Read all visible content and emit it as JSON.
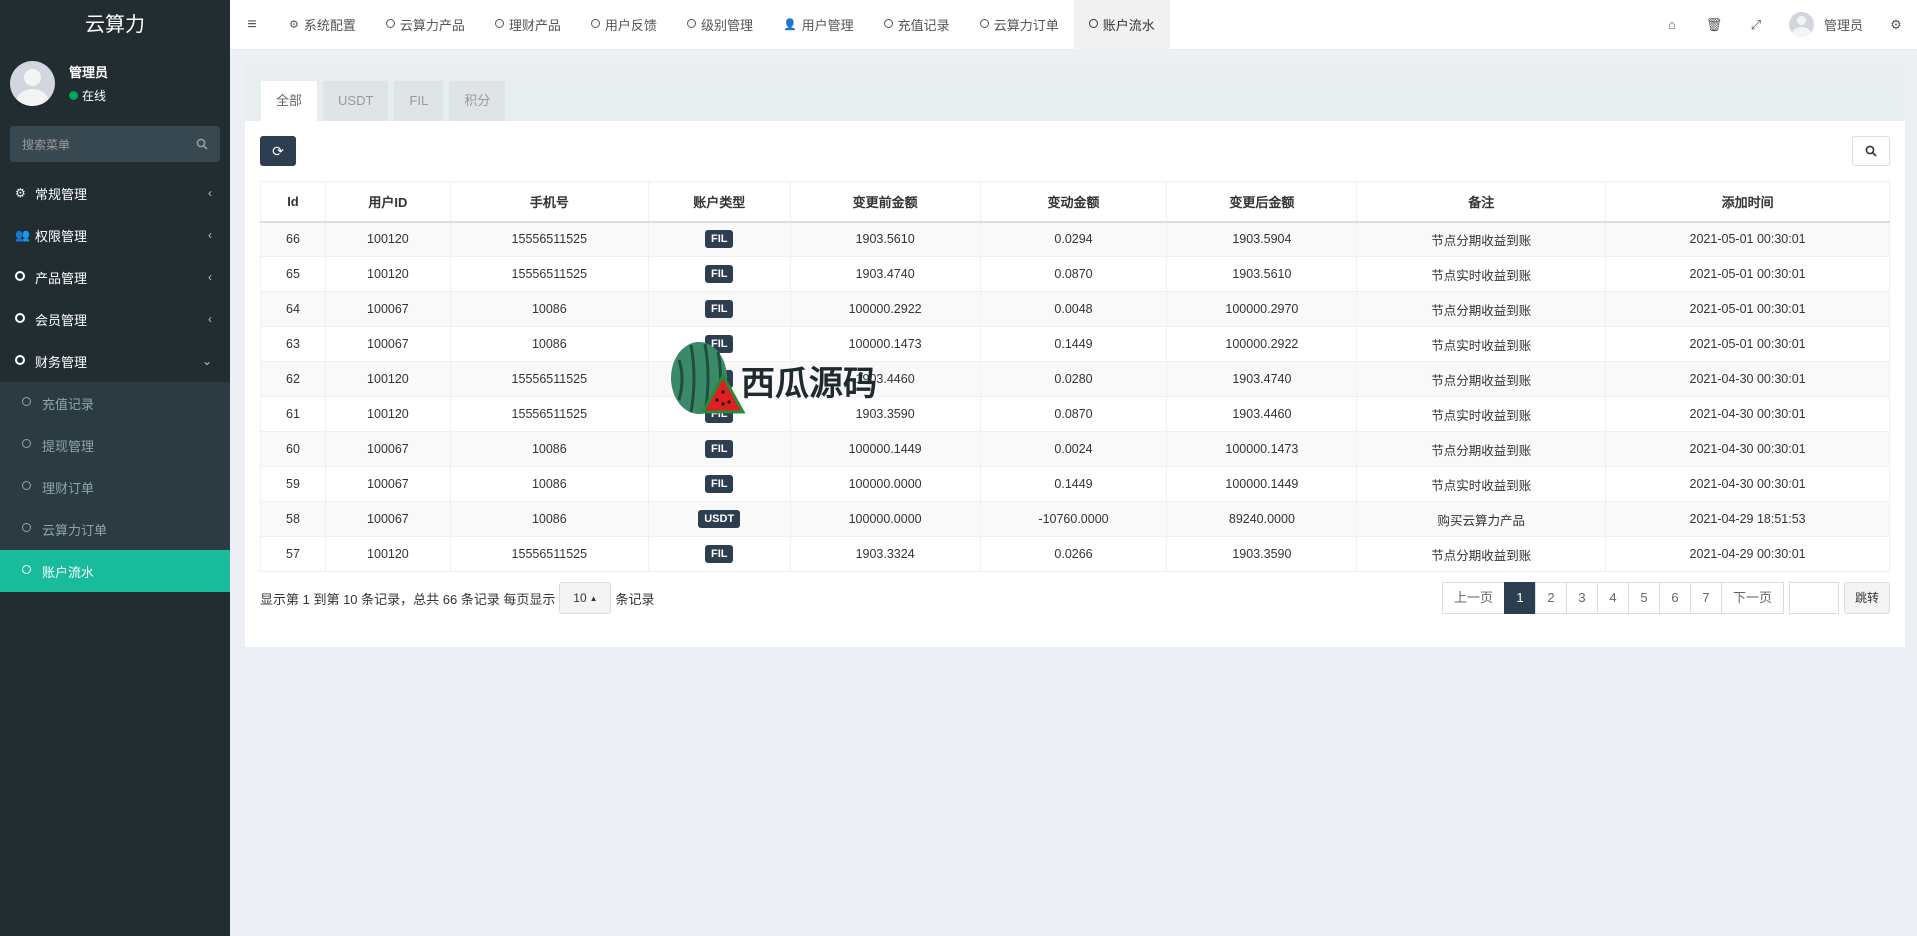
{
  "app": {
    "logo": "云算力",
    "user_name": "管理员",
    "user_status": "在线",
    "search_placeholder": "搜索菜单"
  },
  "sidebar": {
    "items": [
      {
        "label": "常规管理",
        "icon": "cogs-icon"
      },
      {
        "label": "权限管理",
        "icon": "users-icon"
      },
      {
        "label": "产品管理",
        "icon": "circle-icon"
      },
      {
        "label": "会员管理",
        "icon": "circle-icon"
      },
      {
        "label": "财务管理",
        "icon": "circle-icon"
      }
    ],
    "subitems": [
      {
        "label": "充值记录"
      },
      {
        "label": "提现管理"
      },
      {
        "label": "理财订单"
      },
      {
        "label": "云算力订单"
      },
      {
        "label": "账户流水"
      }
    ]
  },
  "topnav": {
    "tabs": [
      {
        "label": "系统配置",
        "icon": "gear-icon"
      },
      {
        "label": "云算力产品",
        "icon": "circle-icon"
      },
      {
        "label": "理财产品",
        "icon": "circle-icon"
      },
      {
        "label": "用户反馈",
        "icon": "circle-icon"
      },
      {
        "label": "级别管理",
        "icon": "circle-icon"
      },
      {
        "label": "用户管理",
        "icon": "user-icon"
      },
      {
        "label": "充值记录",
        "icon": "circle-icon"
      },
      {
        "label": "云算力订单",
        "icon": "circle-icon"
      },
      {
        "label": "账户流水",
        "icon": "circle-icon"
      }
    ],
    "user_label": "管理员"
  },
  "content": {
    "tabs": [
      "全部",
      "USDT",
      "FIL",
      "积分"
    ],
    "columns": [
      "Id",
      "用户ID",
      "手机号",
      "账户类型",
      "变更前金额",
      "变动金额",
      "变更后金额",
      "备注",
      "添加时间"
    ],
    "rows": [
      [
        "66",
        "100120",
        "15556511525",
        "FIL",
        "1903.5610",
        "0.0294",
        "1903.5904",
        "节点分期收益到账",
        "2021-05-01 00:30:01"
      ],
      [
        "65",
        "100120",
        "15556511525",
        "FIL",
        "1903.4740",
        "0.0870",
        "1903.5610",
        "节点实时收益到账",
        "2021-05-01 00:30:01"
      ],
      [
        "64",
        "100067",
        "10086",
        "FIL",
        "100000.2922",
        "0.0048",
        "100000.2970",
        "节点分期收益到账",
        "2021-05-01 00:30:01"
      ],
      [
        "63",
        "100067",
        "10086",
        "FIL",
        "100000.1473",
        "0.1449",
        "100000.2922",
        "节点实时收益到账",
        "2021-05-01 00:30:01"
      ],
      [
        "62",
        "100120",
        "15556511525",
        "FIL",
        "1903.4460",
        "0.0280",
        "1903.4740",
        "节点分期收益到账",
        "2021-04-30 00:30:01"
      ],
      [
        "61",
        "100120",
        "15556511525",
        "FIL",
        "1903.3590",
        "0.0870",
        "1903.4460",
        "节点实时收益到账",
        "2021-04-30 00:30:01"
      ],
      [
        "60",
        "100067",
        "10086",
        "FIL",
        "100000.1449",
        "0.0024",
        "100000.1473",
        "节点分期收益到账",
        "2021-04-30 00:30:01"
      ],
      [
        "59",
        "100067",
        "10086",
        "FIL",
        "100000.0000",
        "0.1449",
        "100000.1449",
        "节点实时收益到账",
        "2021-04-30 00:30:01"
      ],
      [
        "58",
        "100067",
        "10086",
        "USDT",
        "100000.0000",
        "-10760.0000",
        "89240.0000",
        "购买云算力产品",
        "2021-04-29 18:51:53"
      ],
      [
        "57",
        "100120",
        "15556511525",
        "FIL",
        "1903.3324",
        "0.0266",
        "1903.3590",
        "节点分期收益到账",
        "2021-04-29 00:30:01"
      ]
    ],
    "footer": {
      "info_before": "显示第 1 到第 10 条记录，总共 66 条记录 每页显示",
      "page_size": "10",
      "info_after": "条记录"
    },
    "pagination": {
      "prev": "上一页",
      "pages": [
        "1",
        "2",
        "3",
        "4",
        "5",
        "6",
        "7"
      ],
      "next": "下一页",
      "jump": "跳转"
    }
  },
  "watermark": {
    "text": "西瓜源码"
  },
  "colors": {
    "sidebar_bg": "#222d32",
    "accent": "#18bc9c",
    "primary": "#2c3e50"
  }
}
